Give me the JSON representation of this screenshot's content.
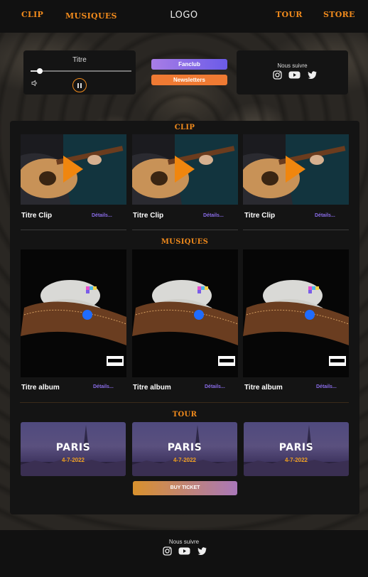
{
  "nav": {
    "clip": "CLIP",
    "musiques": "MUSIQUES",
    "logo": "LOGO",
    "tour": "TOUR",
    "store": "STORE"
  },
  "player": {
    "title": "Titre",
    "progress": 0.09
  },
  "buttons": {
    "fanclub": "Fanclub",
    "newsletters": "Newsletters",
    "buy_ticket": "BUY TICKET"
  },
  "follow": {
    "title": "Nous suivre",
    "icons": [
      "instagram-icon",
      "youtube-icon",
      "twitter-icon"
    ]
  },
  "sections": {
    "clip": "CLIP",
    "musiques": "MUSIQUES",
    "tour": "TOUR"
  },
  "clips": [
    {
      "title": "Titre Clip",
      "details": "Détails..."
    },
    {
      "title": "Titre Clip",
      "details": "Détails..."
    },
    {
      "title": "Titre Clip",
      "details": "Détails..."
    }
  ],
  "albums": [
    {
      "title": "Titre album",
      "details": "Détails..."
    },
    {
      "title": "Titre album",
      "details": "Détails..."
    },
    {
      "title": "Titre album",
      "details": "Détails..."
    }
  ],
  "tours": [
    {
      "city": "PARIS",
      "date": "4-7-2022"
    },
    {
      "city": "PARIS",
      "date": "4-7-2022"
    },
    {
      "city": "PARIS",
      "date": "4-7-2022"
    }
  ],
  "footer": {
    "title": "Nous suivre"
  },
  "colors": {
    "accent": "#f08a1c",
    "link": "#8a6ce8"
  }
}
